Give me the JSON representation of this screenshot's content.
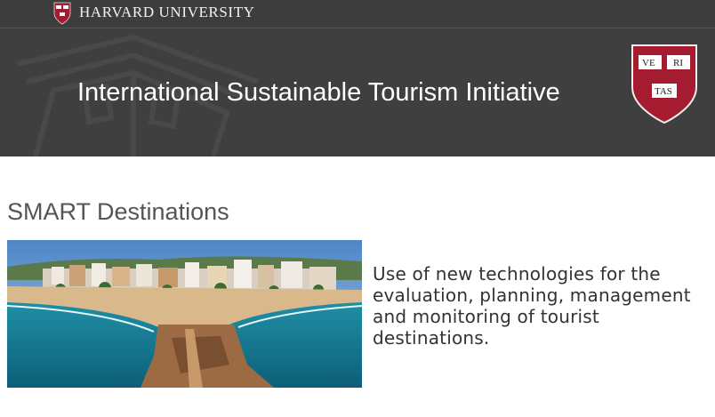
{
  "header": {
    "university": "HARVARD UNIVERSITY",
    "shield_text": [
      "VE",
      "RI",
      "TAS"
    ]
  },
  "banner": {
    "title": "International Sustainable Tourism Initiative",
    "shield_text": [
      "VE",
      "RI",
      "TAS"
    ]
  },
  "content": {
    "heading": "SMART Destinations",
    "description": "Use of new technologies for the evaluation, planning, management and monitoring of tourist destinations.",
    "image_description": "coastal-town-beach-photo"
  },
  "colors": {
    "topbar": "#3d3d3d",
    "banner": "#3f3f3f",
    "crimson": "#a51c30",
    "heading": "#555555"
  }
}
